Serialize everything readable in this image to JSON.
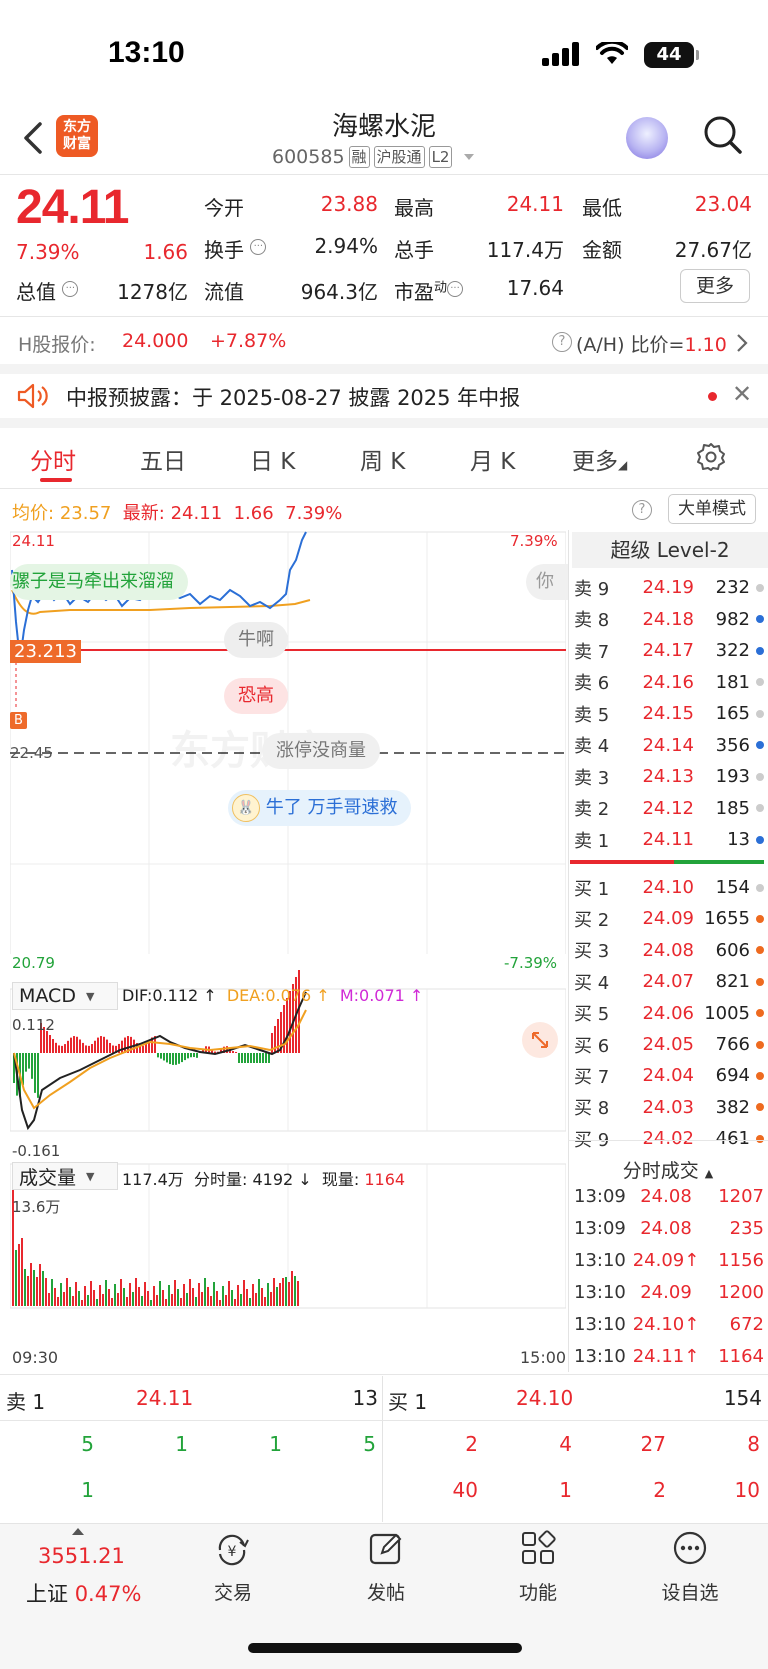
{
  "status_bar": {
    "time": "13:10",
    "battery": "44"
  },
  "header": {
    "logo_line1": "东方",
    "logo_line2": "财富",
    "stock_name": "海螺水泥",
    "stock_code": "600585",
    "tags": [
      "融",
      "沪股通",
      "L2"
    ]
  },
  "quote": {
    "price": "24.11",
    "change_pct": "7.39%",
    "change": "1.66",
    "open_label": "今开",
    "open": "23.88",
    "high_label": "最高",
    "high": "24.11",
    "low_label": "最低",
    "low": "23.04",
    "turnover_label": "换手",
    "turnover": "2.94%",
    "volume_label": "总手",
    "volume": "117.4万",
    "amount_label": "金额",
    "amount": "27.67亿",
    "mktcap_label": "总值",
    "mktcap": "1278亿",
    "float_label": "流值",
    "float": "964.3亿",
    "pe_label": "市盈",
    "pe_sup": "动",
    "pe": "17.64",
    "more_label": "更多"
  },
  "hshare": {
    "label": "H股报价:",
    "price": "24.000",
    "pct": "+7.87%",
    "ah_label": "(A/H) 比价=",
    "ah_value": "1.10"
  },
  "notice": {
    "text": "中报预披露：于 2025-08-27 披露 2025 年中报"
  },
  "tabs": [
    "分时",
    "五日",
    "日 K",
    "周 K",
    "月 K",
    "更多"
  ],
  "chart_info": {
    "avg_label": "均价:",
    "avg": "23.57",
    "latest_label": "最新:",
    "latest": "24.11",
    "change": "1.66",
    "pct": "7.39%",
    "big_order_label": "大单模式"
  },
  "chart_labels": {
    "top_price": "24.11",
    "top_pct": "7.39%",
    "bottom_price": "20.79",
    "bottom_pct": "-7.39%",
    "cursor_price": "23.213",
    "mid_price": "22.45",
    "b_marker": "B",
    "time_start": "09:30",
    "time_end": "15:00"
  },
  "danmu": {
    "d1": "骡子是马牵出来溜溜",
    "d2": "牛啊",
    "d3": "恐高",
    "d4": "涨停没商量",
    "d5": "牛了  万手哥速救",
    "d6": "你"
  },
  "macd": {
    "selector": "MACD",
    "dif": "DIF:0.112 ↑",
    "dea": "DEA:0.076 ↑",
    "m": "M:0.071 ↑",
    "top": "0.112",
    "bottom": "-0.161"
  },
  "volume_panel": {
    "selector": "成交量",
    "total": "117.4万",
    "minute_label": "分时量:",
    "minute": "4192 ↓",
    "now_label": "现量:",
    "now": "1164",
    "top": "13.6万"
  },
  "order_book": {
    "title": "超级 Level-2",
    "asks": [
      {
        "label": "卖 9",
        "price": "24.19",
        "vol": "232",
        "dot": "#cccccc"
      },
      {
        "label": "卖 8",
        "price": "24.18",
        "vol": "982",
        "dot": "#2b6fd6"
      },
      {
        "label": "卖 7",
        "price": "24.17",
        "vol": "322",
        "dot": "#2b6fd6"
      },
      {
        "label": "卖 6",
        "price": "24.16",
        "vol": "181",
        "dot": "#cccccc"
      },
      {
        "label": "卖 5",
        "price": "24.15",
        "vol": "165",
        "dot": "#cccccc"
      },
      {
        "label": "卖 4",
        "price": "24.14",
        "vol": "356",
        "dot": "#2b6fd6"
      },
      {
        "label": "卖 3",
        "price": "24.13",
        "vol": "193",
        "dot": "#cccccc"
      },
      {
        "label": "卖 2",
        "price": "24.12",
        "vol": "185",
        "dot": "#cccccc"
      },
      {
        "label": "卖 1",
        "price": "24.11",
        "vol": "13",
        "dot": "#2b6fd6"
      }
    ],
    "bids": [
      {
        "label": "买 1",
        "price": "24.10",
        "vol": "154",
        "dot": "#cccccc"
      },
      {
        "label": "买 2",
        "price": "24.09",
        "vol": "1655",
        "dot": "#ee6a1f"
      },
      {
        "label": "买 3",
        "price": "24.08",
        "vol": "606",
        "dot": "#ee6a1f"
      },
      {
        "label": "买 4",
        "price": "24.07",
        "vol": "821",
        "dot": "#ee6a1f"
      },
      {
        "label": "买 5",
        "price": "24.06",
        "vol": "1005",
        "dot": "#ee6a1f"
      },
      {
        "label": "买 6",
        "price": "24.05",
        "vol": "766",
        "dot": "#ee6a1f"
      },
      {
        "label": "买 7",
        "price": "24.04",
        "vol": "694",
        "dot": "#ee6a1f"
      },
      {
        "label": "买 8",
        "price": "24.03",
        "vol": "382",
        "dot": "#ee6a1f"
      },
      {
        "label": "买 9",
        "price": "24.02",
        "vol": "461",
        "dot": "#ee6a1f"
      }
    ],
    "trades_title": "分时成交",
    "trades": [
      {
        "time": "13:09",
        "price": "24.08",
        "vol": "1207"
      },
      {
        "time": "13:09",
        "price": "24.08",
        "vol": "235"
      },
      {
        "time": "13:10",
        "price": "24.09↑",
        "vol": "1156"
      },
      {
        "time": "13:10",
        "price": "24.09",
        "vol": "1200"
      },
      {
        "time": "13:10",
        "price": "24.10↑",
        "vol": "672"
      },
      {
        "time": "13:10",
        "price": "24.11↑",
        "vol": "1164"
      }
    ]
  },
  "level_bar": {
    "ask_label": "卖 1",
    "ask_price": "24.11",
    "ask_vol": "13",
    "bid_label": "买 1",
    "bid_price": "24.10",
    "bid_vol": "154",
    "ask_queue_row1": [
      "5",
      "1",
      "1",
      "5"
    ],
    "ask_queue_row2": [
      "1"
    ],
    "bid_queue_row1": [
      "2",
      "4",
      "27",
      "8"
    ],
    "bid_queue_row2": [
      "40",
      "1",
      "2",
      "10"
    ]
  },
  "bottom_nav": {
    "index_value": "3551.21",
    "index_name": "上证",
    "index_pct": "0.47%",
    "trade": "交易",
    "post": "发帖",
    "function": "功能",
    "watchlist": "设自选"
  }
}
